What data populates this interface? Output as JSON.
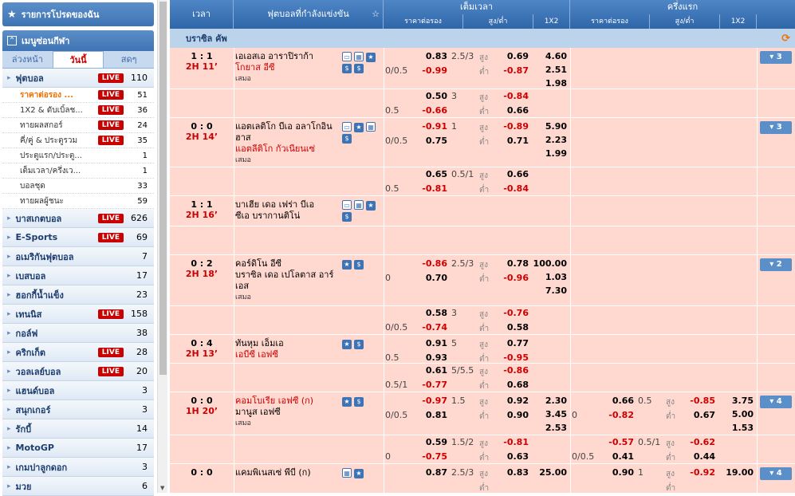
{
  "sidebar": {
    "favorites_label": "รายการโปรดของฉัน",
    "menu_label": "เมนูซ่อนกีฬา",
    "tabs": [
      "ล่วงหน้า",
      "วันนี้",
      "สดๆ"
    ],
    "items": [
      {
        "name": "ฟุตบอล",
        "live": "LIVE",
        "count": "110",
        "type": "sport"
      },
      {
        "name": "ราคาต่อรอง ...",
        "live": "LIVE",
        "count": "51",
        "type": "sub",
        "selected": true
      },
      {
        "name": "1X2 & ดับเบิ้ลช...",
        "live": "LIVE",
        "count": "36",
        "type": "sub"
      },
      {
        "name": "ทายผลสกอร์",
        "live": "LIVE",
        "count": "24",
        "type": "sub"
      },
      {
        "name": "คี่/คู่ & ประตูรวม",
        "live": "LIVE",
        "count": "35",
        "type": "sub"
      },
      {
        "name": "ประตูแรก/ประตู...",
        "live": "",
        "count": "1",
        "type": "sub"
      },
      {
        "name": "เต็มเวลา/ครึ่งเว...",
        "live": "",
        "count": "1",
        "type": "sub"
      },
      {
        "name": "บอลชุด",
        "live": "",
        "count": "33",
        "type": "sub"
      },
      {
        "name": "ทายผลผู้ชนะ",
        "live": "",
        "count": "59",
        "type": "sub"
      },
      {
        "name": "บาสเกตบอล",
        "live": "LIVE",
        "count": "626",
        "type": "sport"
      },
      {
        "name": "E-Sports",
        "live": "LIVE",
        "count": "69",
        "type": "sport"
      },
      {
        "name": "อเมริกันฟุตบอล",
        "live": "",
        "count": "7",
        "type": "sport"
      },
      {
        "name": "เบสบอล",
        "live": "",
        "count": "17",
        "type": "sport"
      },
      {
        "name": "ฮอกกี้น้ำแข็ง",
        "live": "",
        "count": "23",
        "type": "sport"
      },
      {
        "name": "เทนนิส",
        "live": "LIVE",
        "count": "158",
        "type": "sport"
      },
      {
        "name": "กอล์ฟ",
        "live": "",
        "count": "38",
        "type": "sport"
      },
      {
        "name": "คริกเก็ต",
        "live": "LIVE",
        "count": "28",
        "type": "sport"
      },
      {
        "name": "วอลเลย์บอล",
        "live": "LIVE",
        "count": "20",
        "type": "sport"
      },
      {
        "name": "แฮนด์บอล",
        "live": "",
        "count": "3",
        "type": "sport"
      },
      {
        "name": "สนุกเกอร์",
        "live": "",
        "count": "3",
        "type": "sport"
      },
      {
        "name": "รักบี้",
        "live": "",
        "count": "14",
        "type": "sport"
      },
      {
        "name": "MotoGP",
        "live": "",
        "count": "17",
        "type": "sport"
      },
      {
        "name": "เกมปาลูกดอก",
        "live": "",
        "count": "3",
        "type": "sport"
      },
      {
        "name": "มวย",
        "live": "",
        "count": "6",
        "type": "sport"
      }
    ]
  },
  "header": {
    "time": "เวลา",
    "match": "ฟุตบอลที่กำลังแข่งขัน",
    "fulltime": "เต็มเวลา",
    "firsthalf": "ครึ่งแรก",
    "hdp": "ราคาต่อรอง",
    "ou": "สูง/ต่ำ",
    "x12": "1X2"
  },
  "league": "บราซิล คัพ",
  "labels": {
    "over": "สูง",
    "under": "ต่ำ",
    "draw": "เสมอ"
  },
  "matches": [
    {
      "score": "1 : 1",
      "time": "2H 11",
      "home": "เอเอสเอ อาราปิราก้า",
      "away": "โกยาส อีซี",
      "away_fav": true,
      "draw": "เสมอ",
      "icons": [
        "tv",
        "st",
        "fv",
        "pr",
        "pr"
      ],
      "more": "▾ 3",
      "ft": {
        "hdp": "0/0.5",
        "h1": "0.83",
        "h2": "-0.99",
        "ou": "2.5/3",
        "o1": "0.69",
        "o2": "-0.87",
        "x": [
          "4.60",
          "2.51",
          "1.98"
        ]
      },
      "ft2": {
        "hdp": "0.5",
        "h1": "0.50",
        "h2": "-0.66",
        "ou": "3",
        "o1": "-0.84",
        "o2": "0.66"
      }
    },
    {
      "score": "0 : 0",
      "time": "2H 14",
      "home": "แอตเลติโก บีเอ อลาโกอินฮาส",
      "away": "แอตลีติโก กัวเนียนเซ่",
      "away_fav": true,
      "draw": "เสมอ",
      "icons": [
        "tv",
        "fv",
        "st",
        "pr"
      ],
      "more": "▾ 3",
      "ft": {
        "hdp": "0/0.5",
        "h1": "-0.91",
        "h2": "0.75",
        "ou": "1",
        "o1": "-0.89",
        "o2": "0.71",
        "x": [
          "5.90",
          "2.23",
          "1.99"
        ]
      },
      "ft2": {
        "hdp": "0.5",
        "h1": "0.65",
        "h2": "-0.81",
        "ou": "0.5/1",
        "o1": "0.66",
        "o2": "-0.84"
      }
    },
    {
      "score": "1 : 1",
      "time": "2H 16",
      "home": "บาเฮีย เดอ เฟร่า บีเอ",
      "away": "ซีเอ บรากานติโน่",
      "away_fav": false,
      "draw": "",
      "icons": [
        "tv",
        "st",
        "fv",
        "pr"
      ],
      "more": ""
    },
    {
      "score": "0 : 2",
      "time": "2H 18",
      "home": "คอร์ดิโน อีซี",
      "away": "บราซิล เดอ เปโลตาส อาร์เอส",
      "away_fav": false,
      "draw": "เสมอ",
      "icons": [
        "fv",
        "pr"
      ],
      "more": "▾ 2",
      "ft": {
        "hdp": "0",
        "h1": "-0.86",
        "h2": "0.70",
        "ou": "2.5/3",
        "o1": "0.78",
        "o2": "-0.96",
        "x": [
          "100.00",
          "1.03",
          "7.30"
        ]
      },
      "ft2": {
        "hdp": "0/0.5",
        "h1": "0.58",
        "h2": "-0.74",
        "ou": "3",
        "o1": "-0.76",
        "o2": "0.58"
      }
    },
    {
      "score": "0 : 4",
      "time": "2H 13",
      "home": "ทันหุม เอ็มเอ",
      "away": "เอบีซี เอฟซี",
      "away_fav": true,
      "draw": "",
      "icons": [
        "fv",
        "pr"
      ],
      "more": "",
      "ft": {
        "hdp": "0.5",
        "h1": "0.91",
        "h2": "0.93",
        "ou": "5",
        "o1": "0.77",
        "o2": "-0.95",
        "x": []
      },
      "ft2": {
        "hdp": "0.5/1",
        "h1": "0.61",
        "h2": "-0.77",
        "ou": "5/5.5",
        "o1": "-0.86",
        "o2": "0.68"
      }
    },
    {
      "score": "0 : 0",
      "time": "1H 20",
      "home": "คอมโบเรีย เอฟซี (ก)",
      "away": "มานูส เอฟซี",
      "home_fav": true,
      "away_fav": false,
      "draw": "เสมอ",
      "icons": [
        "fv",
        "pr"
      ],
      "more": "▾ 4",
      "ft": {
        "hdp": "0/0.5",
        "h1": "-0.97",
        "h2": "0.81",
        "ou": "1.5",
        "o1": "0.92",
        "o2": "0.90",
        "x": [
          "2.30",
          "3.45",
          "2.53"
        ]
      },
      "fh": {
        "hdp": "0",
        "h1": "0.66",
        "h2": "-0.82",
        "ou": "0.5",
        "o1": "-0.85",
        "o2": "0.67",
        "x": [
          "3.75",
          "5.00",
          "1.53"
        ]
      },
      "ft2": {
        "hdp": "0",
        "h1": "0.59",
        "h2": "-0.75",
        "ou": "1.5/2",
        "o1": "-0.81",
        "o2": "0.63"
      },
      "fh2": {
        "hdp": "0/0.5",
        "h1": "-0.57",
        "h2": "0.41",
        "ou": "0.5/1",
        "o1": "-0.62",
        "o2": "0.44"
      }
    },
    {
      "score": "0 : 0",
      "time": "",
      "home": "แคมพิเนสเซ่ พีบี (ก)",
      "away": "",
      "home_fav": false,
      "away_fav": false,
      "draw": "",
      "icons": [
        "st",
        "fv"
      ],
      "more": "▾ 4",
      "ft": {
        "hdp": "",
        "h1": "0.87",
        "h2": "",
        "ou": "2.5/3",
        "o1": "0.83",
        "o2": "",
        "x": [
          "25.00"
        ]
      },
      "fh": {
        "hdp": "",
        "h1": "0.90",
        "h2": "",
        "ou": "1",
        "o1": "-0.92",
        "o2": "",
        "x": [
          "19.00"
        ]
      }
    }
  ],
  "colors": {
    "accent": "#3f74b4",
    "live": "#c80000",
    "row": "#ffd8cf",
    "negative": "#cc0000"
  }
}
